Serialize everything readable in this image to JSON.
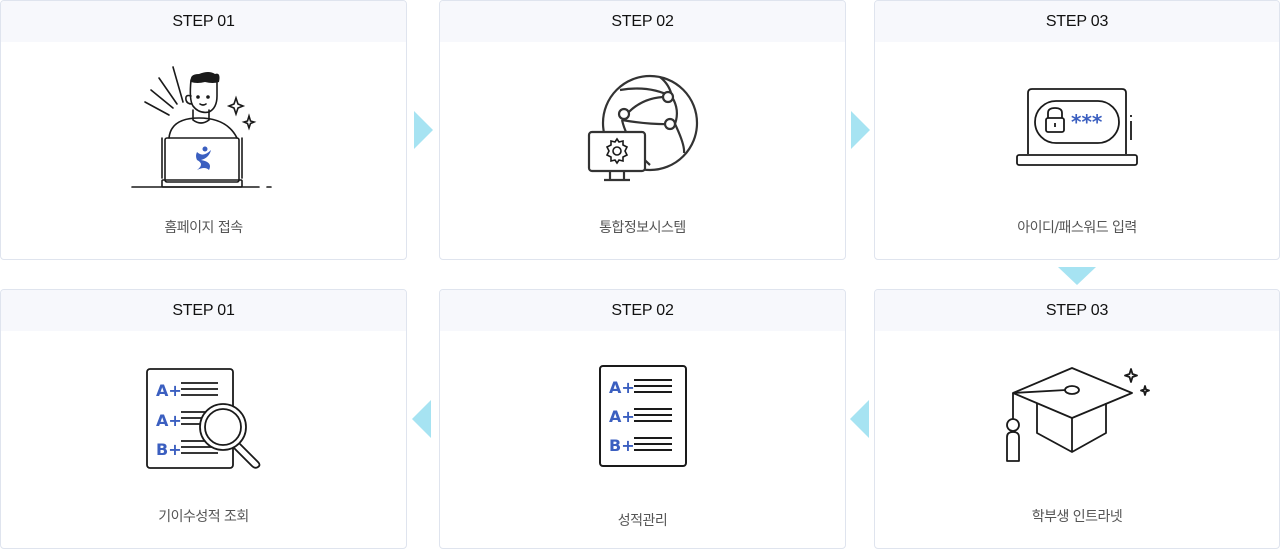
{
  "steps_row1": [
    {
      "step": "STEP 01",
      "label": "홈페이지 접속",
      "icon": "person-laptop-icon"
    },
    {
      "step": "STEP 02",
      "label": "통합정보시스템",
      "icon": "globe-network-monitor-icon"
    },
    {
      "step": "STEP 03",
      "label": "아이디/패스워드 입력",
      "icon": "laptop-password-icon"
    }
  ],
  "steps_row2": [
    {
      "step": "STEP 01",
      "label": "기이수성적 조회",
      "icon": "grade-report-search-icon"
    },
    {
      "step": "STEP 02",
      "label": "성적관리",
      "icon": "grade-report-icon"
    },
    {
      "step": "STEP 03",
      "label": "학부생 인트라넷",
      "icon": "graduation-cap-icon"
    }
  ],
  "password_mask": "***",
  "grades": [
    "A+",
    "A+",
    "B+"
  ],
  "colors": {
    "arrow": "#a6e3f2",
    "accent_blue": "#3b5fc0",
    "card_border": "#dfe4ee",
    "card_header_bg": "#f7f8fc"
  }
}
